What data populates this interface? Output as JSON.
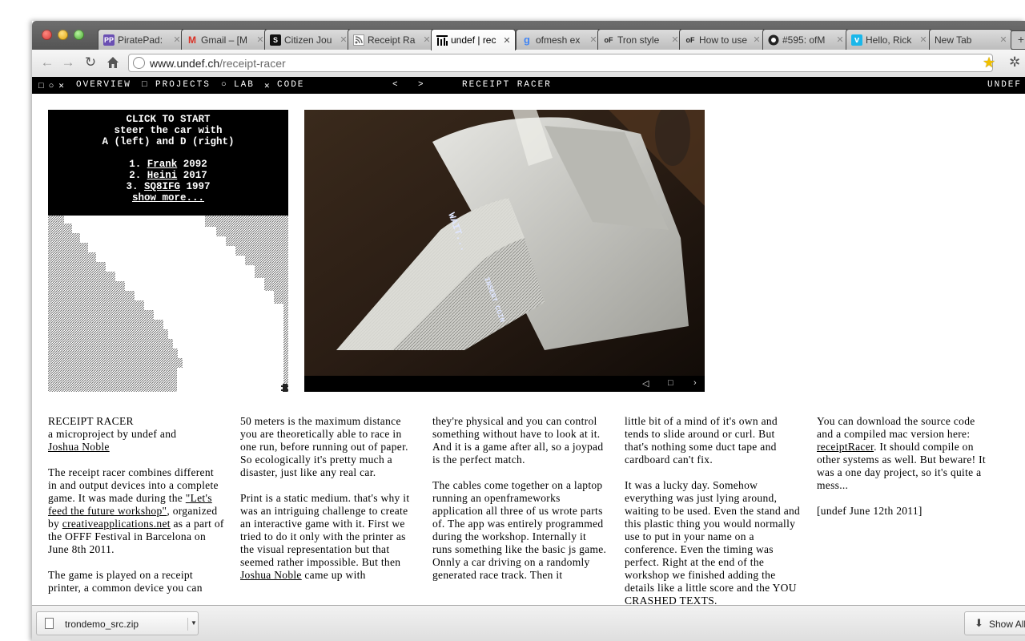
{
  "browser": {
    "tabs": [
      {
        "label": "PiratePad:",
        "icon": "piratepad-icon",
        "fav": "PP",
        "active": false
      },
      {
        "label": "Gmail – [M",
        "icon": "gmail-icon",
        "fav": "M",
        "active": false
      },
      {
        "label": "Citizen Jou",
        "icon": "citizen-journal-icon",
        "fav": "S",
        "active": false
      },
      {
        "label": "Receipt Ra",
        "icon": "rss-icon",
        "fav": "",
        "active": false
      },
      {
        "label": "undef | rec",
        "icon": "undef-icon",
        "fav": "",
        "active": true
      },
      {
        "label": "ofmesh ex",
        "icon": "google-icon",
        "fav": "g",
        "active": false
      },
      {
        "label": "Tron style",
        "icon": "openframeworks-icon",
        "fav": "oF",
        "active": false
      },
      {
        "label": "How to use",
        "icon": "openframeworks-icon",
        "fav": "oF",
        "active": false
      },
      {
        "label": "#595: ofM",
        "icon": "github-icon",
        "fav": "",
        "active": false
      },
      {
        "label": "Hello, Rick",
        "icon": "vimeo-icon",
        "fav": "v",
        "active": false
      },
      {
        "label": "New Tab",
        "icon": "",
        "fav": "",
        "active": false
      }
    ],
    "url_host": "www.undef.ch",
    "url_path": "/receipt-racer"
  },
  "site_nav": {
    "items": [
      "OVERVIEW",
      "PROJECTS",
      "LAB",
      "CODE"
    ],
    "page_title": "RECEIPT RACER",
    "brand": "UNDEF"
  },
  "game": {
    "line1": "CLICK TO START",
    "line2": "steer the car with",
    "line3": "A (left) and D (right)",
    "scores": [
      {
        "rank": "1.",
        "name": "Frank",
        "score": "2092"
      },
      {
        "rank": "2.",
        "name": "Heini",
        "score": "2017"
      },
      {
        "rank": "3.",
        "name": "SQ8IFG",
        "score": "1997"
      }
    ],
    "show_more": "show more..."
  },
  "article": {
    "col1": {
      "title": "RECEIPT RACER",
      "byline": "a microproject by undef and",
      "author_link": "Joshua Noble",
      "p2_a": "The receipt racer combines different in and output devices into a complete game. It was made during the ",
      "p2_link1": "\"Let's feed the future workshop\"",
      "p2_b": ", organized by ",
      "p2_link2": "creativeapplications.net",
      "p2_c": " as a part of the OFFF Festival in Barcelona on June 8th 2011.",
      "p3": "The game is played on a receipt printer, a common device you can"
    },
    "col2": {
      "p1": "50 meters is the maximum distance you are theoretically able to race in one run, before running out of paper. So ecologically it's pretty much a disaster, just like any real car.",
      "p2_a": "Print is a static medium. that's why it was an intriguing challenge to create an interactive game with it. First we tried to do it only with the printer as the visual representation but that seemed rather impossible. But then ",
      "p2_link": "Joshua Noble",
      "p2_b": " came up with"
    },
    "col3": {
      "p1": "they're physical and you can control something without have to look at it. And it is a game after all, so a joypad is the perfect match.",
      "p2": "The cables come together on a laptop running an openframeworks application all three of us wrote parts of. The app was entirely programmed during the workshop. Internally it runs something like the basic js game. Onnly a car driving on a randomly generated race track. Then it"
    },
    "col4": {
      "p1": "little bit of a mind of it's own and tends to slide around or curl. But that's nothing some duct tape and cardboard can't fix.",
      "p2": "It was a lucky day. Somehow everything was just lying around, waiting to be used. Even the stand and this plastic thing you would normally use to put in your name on a conference. Even the timing was perfect. Right at the end of the workshop we finished adding the details like a little score and the YOU CRASHED TEXTS."
    },
    "col5": {
      "p1_a": "You can download the source code and a compiled mac version here: ",
      "p1_link": "receiptRacer",
      "p1_b": ". It should compile on other systems as well. But beware! It was a one day project, so it's quite a mess...",
      "p2": "[undef June 12th 2011]"
    }
  },
  "downloads": {
    "file": "trondemo_src.zip",
    "show_all": "Show All"
  }
}
